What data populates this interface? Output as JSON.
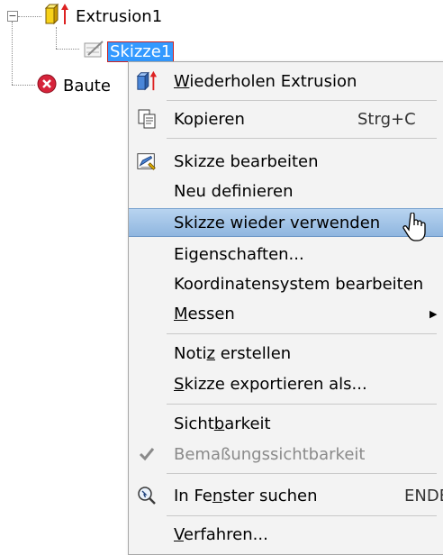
{
  "tree": {
    "extrusion_label": "Extrusion1",
    "sketch_label": "Skizze1",
    "bauteil_label": "Baute"
  },
  "menu": {
    "items": [
      {
        "pre": "",
        "u": "W",
        "post": "iederholen Extrusion",
        "icon": "extrude-icon"
      },
      {
        "pre": "",
        "u": "",
        "post": "Kopieren",
        "shortcut": "Strg+C",
        "icon": "copy-icon"
      },
      {
        "pre": "",
        "u": "",
        "post": "Skizze bearbeiten",
        "icon": "edit-sketch-icon"
      },
      {
        "pre": "",
        "u": "",
        "post": "Neu definieren"
      },
      {
        "pre": "",
        "u": "",
        "post": "Skizze wieder verwenden"
      },
      {
        "pre": "",
        "u": "",
        "post": "Eigenschaften..."
      },
      {
        "pre": "",
        "u": "",
        "post": "Koordinatensystem bearbeiten"
      },
      {
        "pre": "",
        "u": "M",
        "post": "essen"
      },
      {
        "pre": "Noti",
        "u": "z",
        "post": " erstellen"
      },
      {
        "pre": "",
        "u": "S",
        "post": "kizze exportieren als..."
      },
      {
        "pre": "Sicht",
        "u": "b",
        "post": "arkeit"
      },
      {
        "pre": "",
        "u": "",
        "post": "Bemaßungssichtbarkeit",
        "icon": "check-icon"
      },
      {
        "pre": "In Fe",
        "u": "n",
        "post": "ster suchen",
        "shortcut": "ENDE",
        "icon": "find-in-window-icon"
      },
      {
        "pre": "",
        "u": "V",
        "post": "erfahren..."
      }
    ]
  },
  "colors": {
    "menu_bg": "#f3f3f3",
    "highlight": "#a9c8ea",
    "selection": "#3399ff",
    "disabled_text": "#8a8a8a"
  }
}
